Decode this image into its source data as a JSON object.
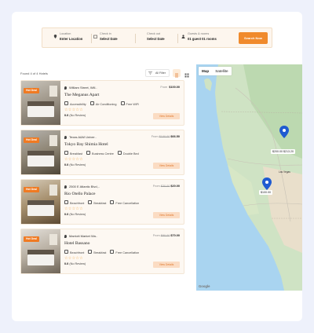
{
  "search": {
    "location": {
      "label": "Location",
      "value": "Enter Location"
    },
    "check_in": {
      "label": "Check in",
      "value": "Select Date"
    },
    "check_out": {
      "label": "Check out",
      "value": "Select Date"
    },
    "guests": {
      "label": "Guests & rooms",
      "value": "01 guest 01 rooms"
    },
    "button": "Search Now"
  },
  "results": {
    "summary": "Found 4 of 4 Hotels",
    "filter_label": "All Filter"
  },
  "hotels": [
    {
      "badge": "Hot Deal",
      "address": "William Street, Will..",
      "price_prefix": "From",
      "old_price": "",
      "price": "$100.00",
      "name": "The Meganus Apart",
      "amenities": [
        "Accessibility",
        "Air Conditioning",
        "Free WiFi"
      ],
      "stars": "☆☆☆☆☆",
      "rating": "0.0",
      "reviews": "(No Review)",
      "button": "View Details"
    },
    {
      "badge": "Hot Deal",
      "address": "Texas A&M Univer..",
      "price_prefix": "From",
      "old_price": "$100.00",
      "price": "$66.50",
      "name": "Tokyo Bay Shimia Hotel",
      "amenities": [
        "Breakfast",
        "Business Centre",
        "Double Bed"
      ],
      "stars": "☆☆☆☆☆",
      "rating": "0.0",
      "reviews": "(No Review)",
      "button": "View Details"
    },
    {
      "badge": "Hot Deal",
      "address": "2500 E Atlantic Blvd,..",
      "price_prefix": "From",
      "old_price": "$30.00",
      "price": "$20.00",
      "name": "Rio Otello Palace",
      "amenities": [
        "Beachfront",
        "Breakfast",
        "Free Cancellation"
      ],
      "stars": "☆☆☆☆☆",
      "rating": "0.0",
      "reviews": "(No Review)",
      "button": "View Details"
    },
    {
      "badge": "Hot Deal",
      "address": "Marriott Market Wa..",
      "price_prefix": "From",
      "old_price": "$80.00",
      "price": "$70.00",
      "name": "Hotel Bassano",
      "amenities": [
        "Beachfront",
        "Breakfast",
        "Free Cancellation"
      ],
      "stars": "☆☆☆☆☆",
      "rating": "0.0",
      "reviews": "(No Review)",
      "button": "View Details"
    }
  ],
  "map": {
    "tabs": [
      "Map",
      "Satellite"
    ],
    "markers": [
      {
        "label": "$200.00 $213.20"
      },
      {
        "label": "$100.00"
      }
    ],
    "city_label": "Las Vegas",
    "attribution": "Google"
  }
}
